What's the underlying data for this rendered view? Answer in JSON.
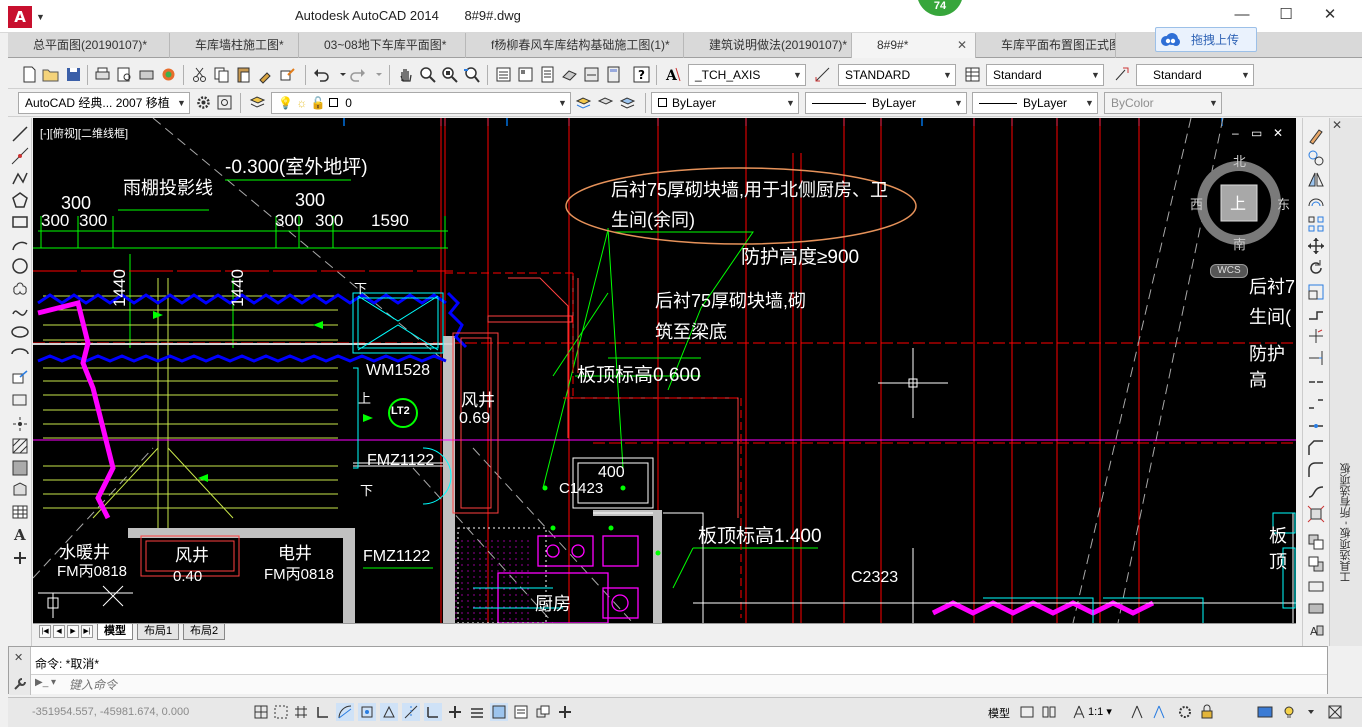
{
  "window": {
    "app_title": "Autodesk AutoCAD 2014",
    "document": "8#9#.dwg",
    "notification_count": "74",
    "minimize": "—",
    "maximize": "☐",
    "close": "✕"
  },
  "tabs": [
    {
      "label": "总平面图(20190107)*"
    },
    {
      "label": "车库墙柱施工图*"
    },
    {
      "label": "03~08地下车库平面图*"
    },
    {
      "label": "f杨柳春风车库结构基础施工图(1)*"
    },
    {
      "label": "建筑说明做法(20190107)*"
    },
    {
      "label": "8#9#*",
      "active": true,
      "close": "✕"
    },
    {
      "label": "车库平面布置图正式图*"
    }
  ],
  "upload_button": "拖拽上传",
  "toolbar1": {
    "text_style": "_TCH_AXIS",
    "dim_style": "STANDARD",
    "table_style": "Standard",
    "multileader_style": "Standard"
  },
  "toolbar2": {
    "workspace": "AutoCAD 经典... 2007 移植",
    "layer": "0",
    "color": "ByLayer",
    "linetype": "ByLayer",
    "lineweight": "ByLayer",
    "plotstyle": "ByColor"
  },
  "viewport": {
    "label": "[-][俯视][二维线框]",
    "controls": [
      "–",
      "▭",
      "✕"
    ]
  },
  "viewcube": {
    "north": "北",
    "south": "南",
    "east": "东",
    "west": "西",
    "top": "上",
    "wcs": "WCS"
  },
  "drawing": {
    "canopy_line": "雨棚投影线",
    "outdoor_level": "-0.300(室外地坪)",
    "dim_300_a": "300",
    "dim_300_b": "300",
    "dim_300_c": "300",
    "dim_300_d": "300",
    "dim_300_e": "300",
    "dim_300_f": "300",
    "dim_1590": "1590",
    "dim_1440_a": "1440",
    "dim_1440_b": "1440",
    "note_north_wall_l1": "后衬75厚砌块墙,用于北侧厨房、卫",
    "note_north_wall_l2": "生间(余同)",
    "guard_height": "防护高度≥900",
    "note_beam_l1": "后衬75厚砌块墙,砌",
    "note_beam_l2": "筑至梁底",
    "slab_level_1": "板顶标高0.600",
    "slab_level_2": "板顶标高1.400",
    "wm_door": "WM1528",
    "lt2": "LT2",
    "air_shaft": "风井",
    "shaft_dim": "0.69",
    "fmz_1": "FMZ1122",
    "fmz_2": "FMZ1122",
    "c1423": "C1423",
    "dim_400": "400",
    "c2323": "C2323",
    "heat_shaft": "水暖井",
    "fm_heat": "FM丙0818",
    "air_shaft_2": "风井",
    "air_dim_2": "0.40",
    "elec_shaft": "电井",
    "fm_elec": "FM丙0818",
    "kitchen": "厨房",
    "partial_right_1": "后衬7",
    "partial_right_2": "生间(",
    "partial_right_3": "防护高",
    "partial_right_4": "板顶",
    "up_1": "上",
    "down_1": "下",
    "down_2": "下"
  },
  "layout_tabs": [
    "模型",
    "布局1",
    "布局2"
  ],
  "palette_label": "工具选项板 - 所有选项板",
  "command": {
    "history": "命令: *取消*",
    "placeholder": "键入命令"
  },
  "status": {
    "coords": "-351954.557, -45981.674, 0.000",
    "model": "模型",
    "scale": "1:1"
  },
  "colors": {
    "canvas_bg": "#000000",
    "wall_gray": "#c0c0c0",
    "red_axis": "#ff0000",
    "green_dim": "#00ff00",
    "magenta": "#ff00ff",
    "blue_break": "#0000ff",
    "cyan_axis": "#0080ff"
  }
}
